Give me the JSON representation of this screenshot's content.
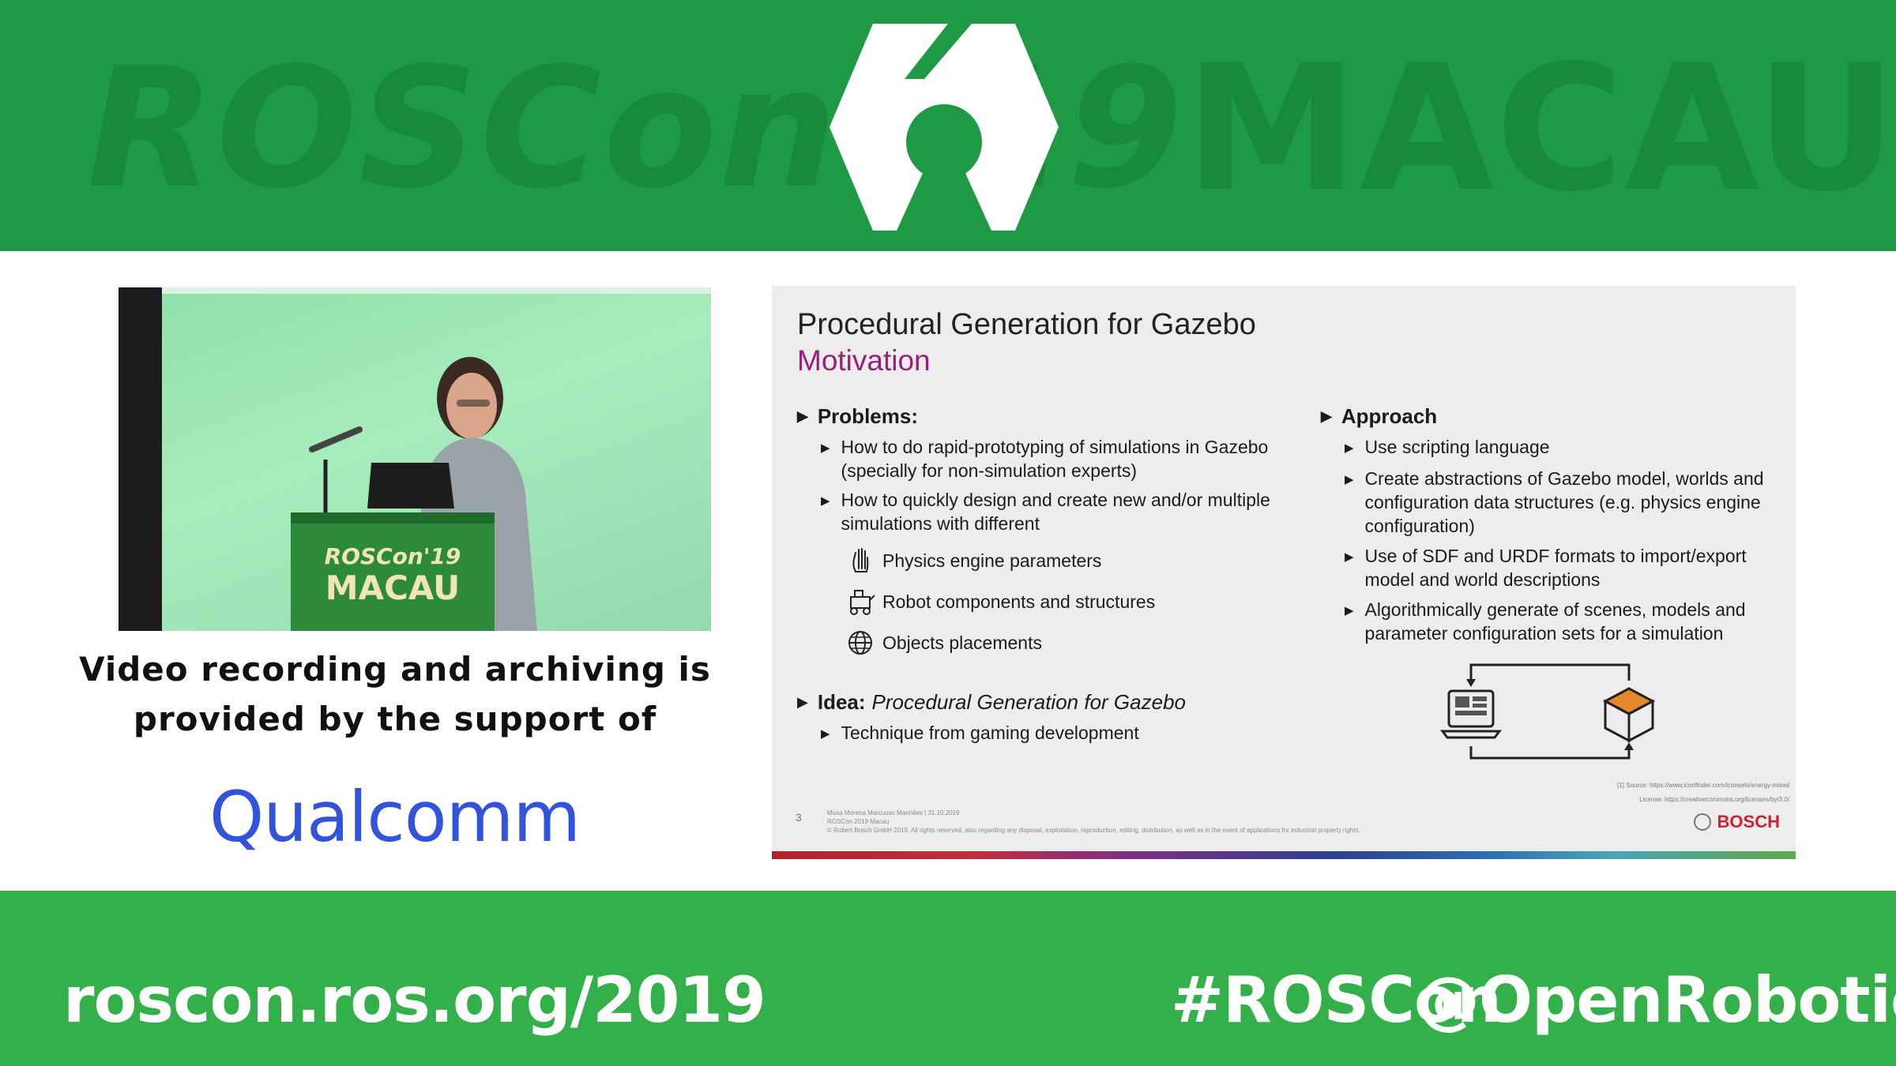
{
  "top_banner": {
    "left_text": "ROSCon '19",
    "right_text": "MACAU",
    "colors": {
      "banner": "#1e9a45",
      "pattern": "#178a3c"
    },
    "logo_icon": "ros-logo-icon"
  },
  "video": {
    "podium_line1": "ROSCon'19",
    "podium_line2": "MACAU"
  },
  "sponsor": {
    "line1": "Video recording and archiving is",
    "line2": "provided by the support of",
    "logo_text": "Qualcomm"
  },
  "slide": {
    "title": "Procedural Generation for Gazebo",
    "subtitle": "Motivation",
    "problems": {
      "heading": "Problems:",
      "items": [
        "How to do rapid-prototyping of simulations in Gazebo (specially for non-simulation experts)",
        "How to quickly design and create new and/or multiple simulations with different"
      ],
      "icon_items": [
        {
          "label": "Physics engine parameters",
          "icon": "hand-icon"
        },
        {
          "label": "Robot components and structures",
          "icon": "robot-icon"
        },
        {
          "label": "Objects placements",
          "icon": "globe-icon"
        }
      ]
    },
    "idea": {
      "label": "Idea:",
      "text": "Procedural Generation for Gazebo",
      "items": [
        "Technique from gaming development"
      ]
    },
    "approach": {
      "heading": "Approach",
      "items": [
        "Use scripting language",
        "Create abstractions of Gazebo model, worlds and configuration data structures (e.g. physics engine configuration)",
        "Use of SDF and URDF formats to import/export model and world descriptions",
        "Algorithmically generate of scenes, models and parameter configuration sets for a simulation"
      ]
    },
    "footer": {
      "page_number": "3",
      "author_line": "Musa Morena Marcusso Manhães | 31.10.2019",
      "event_line": "ROSCon 2019 Macau",
      "copyright": "© Robert Bosch GmbH 2019. All rights reserved, also regarding any disposal, exploitation, reproduction, editing, distribution, as well as in the event of applications for industrial property rights.",
      "source_label": "[1] Source:",
      "source_url": "https://www.iconfinder.com/iconsets/energy-mixed",
      "license_label": "License:",
      "license_url": "https://creativecommons.org/licenses/by/3.0/",
      "brand": "BOSCH"
    }
  },
  "bottom_banner": {
    "url": "roscon.ros.org/2019",
    "hashtag": "#ROSCon",
    "handle": "@OpenRoboticsOrg",
    "color": "#33b049"
  }
}
